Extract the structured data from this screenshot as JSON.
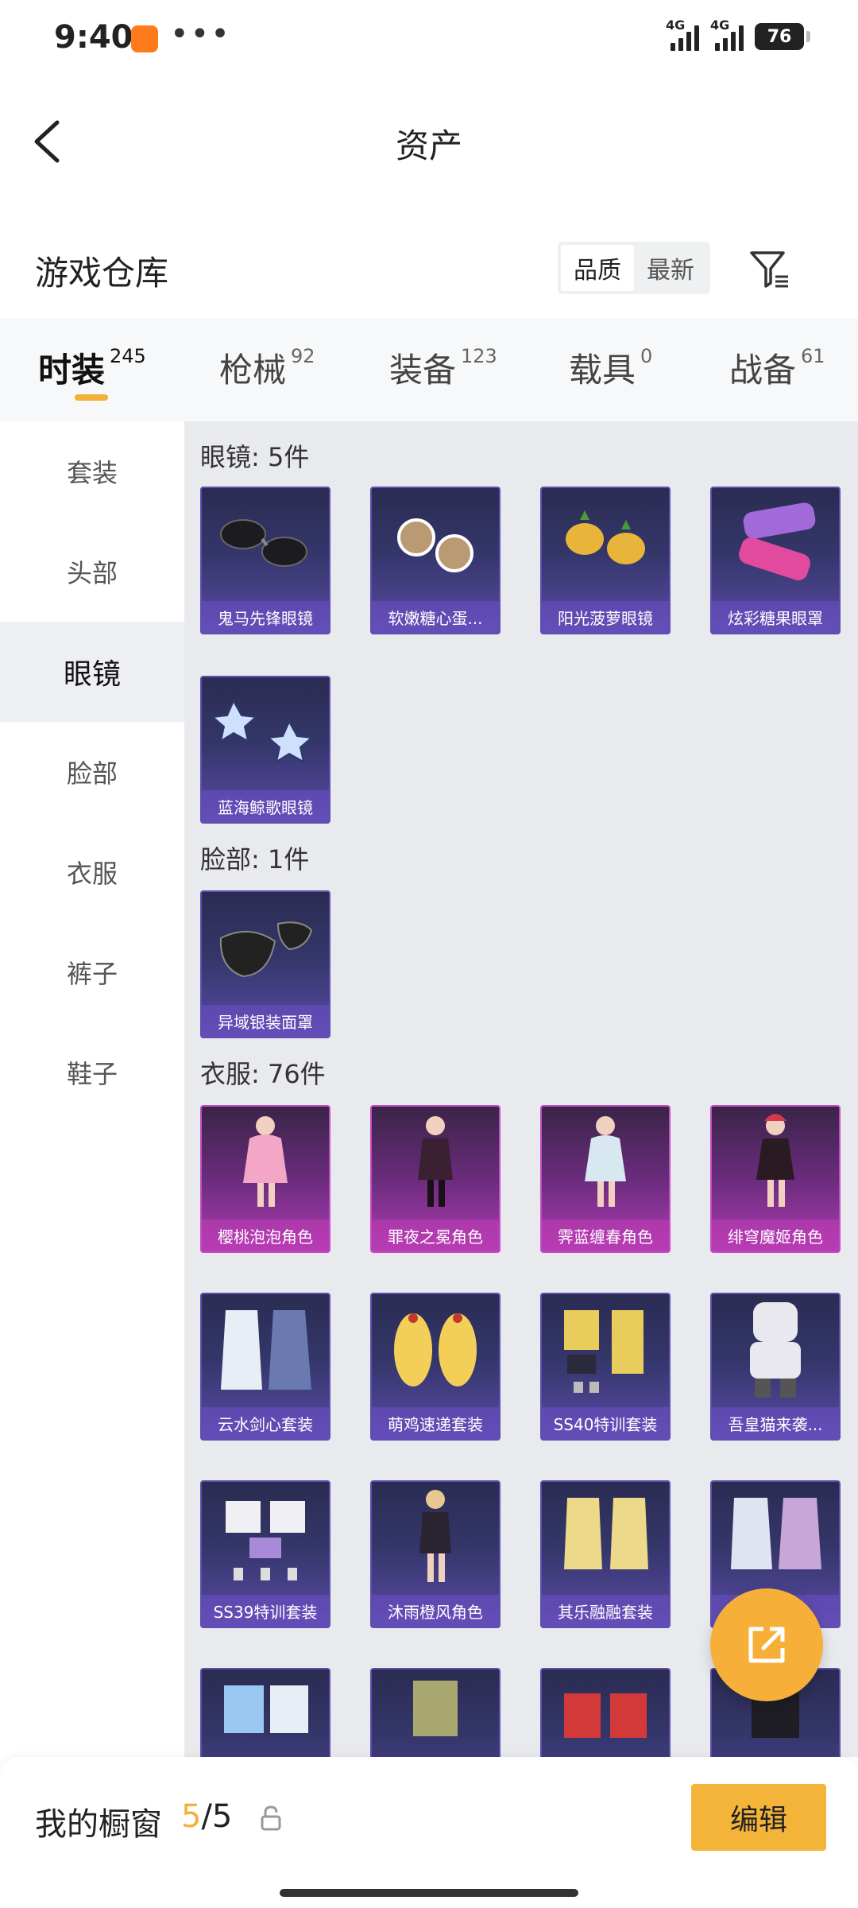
{
  "status": {
    "time": "9:40",
    "net1": "4G",
    "net2": "4G",
    "battery": "76"
  },
  "nav": {
    "title": "资产"
  },
  "warehouse": {
    "title": "游戏仓库",
    "sort_options": [
      {
        "label": "品质",
        "active": true
      },
      {
        "label": "最新",
        "active": false
      }
    ]
  },
  "tabs": [
    {
      "label": "时装",
      "count": "245",
      "active": true
    },
    {
      "label": "枪械",
      "count": "92"
    },
    {
      "label": "装备",
      "count": "123"
    },
    {
      "label": "载具",
      "count": "0"
    },
    {
      "label": "战备",
      "count": "61"
    }
  ],
  "sidebar": {
    "items": [
      {
        "label": "套装"
      },
      {
        "label": "头部"
      },
      {
        "label": "眼镜",
        "active": true
      },
      {
        "label": "脸部"
      },
      {
        "label": "衣服"
      },
      {
        "label": "裤子"
      },
      {
        "label": "鞋子"
      }
    ]
  },
  "sections": [
    {
      "title": "眼镜: 5件",
      "items": [
        "鬼马先锋眼镜",
        "软嫩糖心蛋...",
        "阳光菠萝眼镜",
        "炫彩糖果眼罩",
        "蓝海鲸歌眼镜"
      ]
    },
    {
      "title": "脸部: 1件",
      "items": [
        "异域银装面罩"
      ]
    },
    {
      "title": "衣服: 76件",
      "items": [
        "樱桃泡泡角色",
        "罪夜之冕角色",
        "霁蓝缠春角色",
        "绯穹魔姬角色",
        "云水剑心套装",
        "萌鸡速递套装",
        "SS40特训套装",
        "吾皇猫来袭...",
        "SS39特训套装",
        "沐雨橙风角色",
        "其乐融融套装",
        "装"
      ]
    }
  ],
  "bottom": {
    "shelf_label": "我的橱窗",
    "shelf_used": "5",
    "shelf_total": "/5",
    "edit_label": "编辑"
  },
  "colors": {
    "accent": "#f4b43a",
    "card_purple": "#5a4aa6",
    "card_pink": "#b03cb4"
  }
}
